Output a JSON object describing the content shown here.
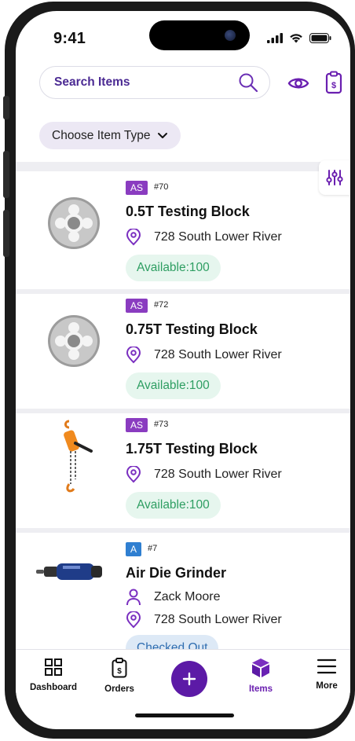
{
  "status_bar": {
    "time": "9:41"
  },
  "header": {
    "search_label": "Search Items",
    "icons": [
      "search-icon",
      "eye-icon",
      "clipboard-dollar-icon"
    ]
  },
  "filter_chip": {
    "label": "Choose Item Type"
  },
  "items": [
    {
      "badge": "AS",
      "badge_color": "#8a3cc0",
      "code": "#70",
      "title": "0.5T Testing Block",
      "location": "728 South Lower River",
      "status": "Available:100"
    },
    {
      "badge": "AS",
      "badge_color": "#8a3cc0",
      "code": "#72",
      "title": "0.75T Testing Block",
      "location": "728 South Lower River",
      "status": "Available:100"
    },
    {
      "badge": "AS",
      "badge_color": "#8a3cc0",
      "code": "#73",
      "title": "1.75T Testing Block",
      "location": "728 South Lower River",
      "status": "Available:100"
    },
    {
      "badge": "A",
      "badge_color": "#2f7fd1",
      "code": "#7",
      "title": "Air Die Grinder",
      "assignee": "Zack Moore",
      "location": "728 South Lower River",
      "status": "Checked Out"
    }
  ],
  "tabbar": {
    "dashboard": "Dashboard",
    "orders": "Orders",
    "items": "Items",
    "more": "More"
  },
  "colors": {
    "accent": "#5c1aa6",
    "available_text": "#2e9e62",
    "checked_out_text": "#2f6db0"
  }
}
